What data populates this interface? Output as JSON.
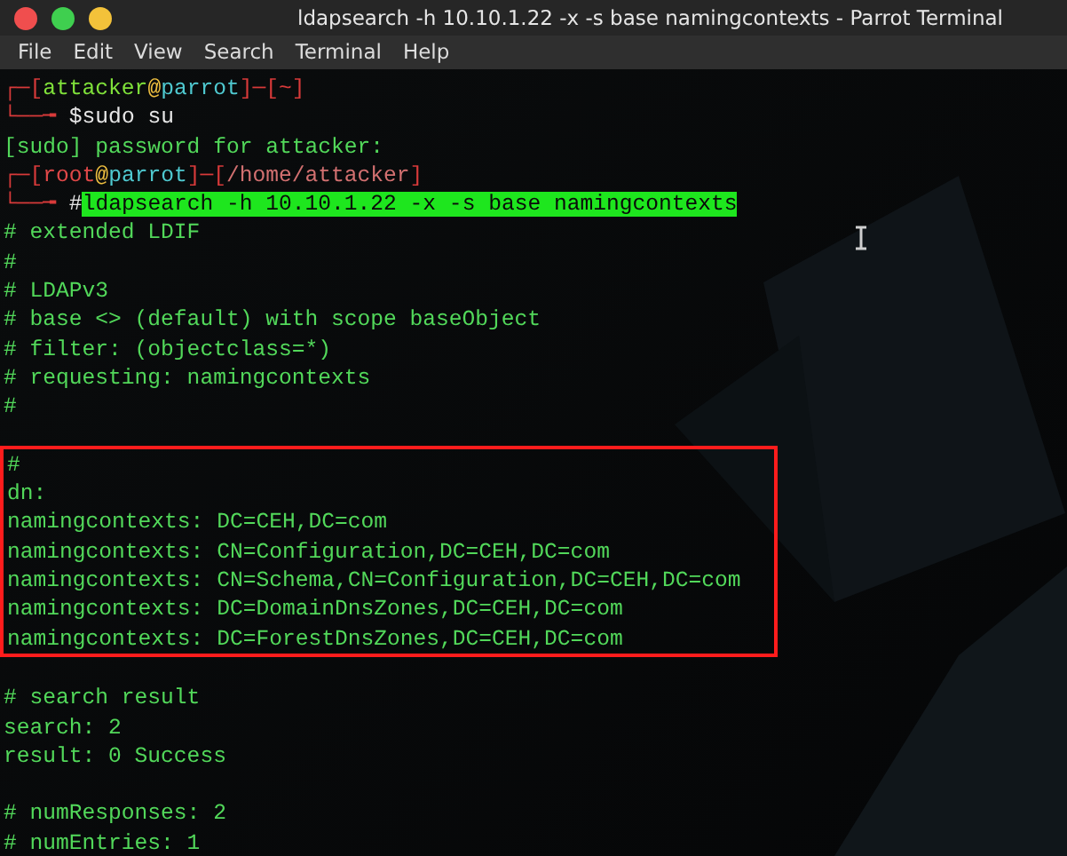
{
  "window": {
    "title": "ldapsearch -h 10.10.1.22 -x -s base namingcontexts - Parrot Terminal",
    "controls": [
      {
        "color": "#f04e4e"
      },
      {
        "color": "#3fcf4f"
      },
      {
        "color": "#f3c23a"
      }
    ]
  },
  "menu": [
    "File",
    "Edit",
    "View",
    "Search",
    "Terminal",
    "Help"
  ],
  "terminal": {
    "blocks": [
      {
        "kind": "plain",
        "lines": [
          {
            "segments": [
              {
                "kind": "frame",
                "text": "┌─["
              },
              {
                "kind": "user",
                "text": "attacker"
              },
              {
                "kind": "at",
                "text": "@"
              },
              {
                "kind": "host",
                "text": "parrot"
              },
              {
                "kind": "frame",
                "text": "]─["
              },
              {
                "kind": "frame",
                "text": "~"
              },
              {
                "kind": "frame",
                "text": "]"
              }
            ]
          },
          {
            "segments": [
              {
                "kind": "frame",
                "text": "└──╼ "
              },
              {
                "kind": "plain",
                "text": "$sudo su"
              }
            ]
          },
          {
            "segments": [
              {
                "kind": "out",
                "text": "[sudo] password for attacker:"
              }
            ]
          },
          {
            "segments": [
              {
                "kind": "frame",
                "text": "┌─["
              },
              {
                "kind": "root",
                "text": "root"
              },
              {
                "kind": "at",
                "text": "@"
              },
              {
                "kind": "host",
                "text": "parrot"
              },
              {
                "kind": "frame",
                "text": "]─["
              },
              {
                "kind": "path",
                "text": "/home/attacker"
              },
              {
                "kind": "frame",
                "text": "]"
              }
            ]
          },
          {
            "segments": [
              {
                "kind": "frame",
                "text": "└──╼ "
              },
              {
                "kind": "plain",
                "text": "#"
              },
              {
                "kind": "highlight",
                "text": "ldapsearch -h 10.10.1.22 -x -s base namingcontexts"
              }
            ]
          },
          {
            "segments": [
              {
                "kind": "out",
                "text": "# extended LDIF"
              }
            ]
          },
          {
            "segments": [
              {
                "kind": "out",
                "text": "#"
              }
            ]
          },
          {
            "segments": [
              {
                "kind": "out",
                "text": "# LDAPv3"
              }
            ]
          },
          {
            "segments": [
              {
                "kind": "out",
                "text": "# base <> (default) with scope baseObject"
              }
            ]
          },
          {
            "segments": [
              {
                "kind": "out",
                "text": "# filter: (objectclass=*)"
              }
            ]
          },
          {
            "segments": [
              {
                "kind": "out",
                "text": "# requesting: namingcontexts"
              }
            ]
          },
          {
            "segments": [
              {
                "kind": "out",
                "text": "#"
              }
            ]
          }
        ]
      },
      {
        "kind": "boxed",
        "lines": [
          {
            "segments": [
              {
                "kind": "out",
                "text": "#"
              }
            ]
          },
          {
            "segments": [
              {
                "kind": "out",
                "text": "dn:"
              }
            ]
          },
          {
            "segments": [
              {
                "kind": "out",
                "text": "namingcontexts: DC=CEH,DC=com"
              }
            ]
          },
          {
            "segments": [
              {
                "kind": "out",
                "text": "namingcontexts: CN=Configuration,DC=CEH,DC=com"
              }
            ]
          },
          {
            "segments": [
              {
                "kind": "out",
                "text": "namingcontexts: CN=Schema,CN=Configuration,DC=CEH,DC=com"
              }
            ]
          },
          {
            "segments": [
              {
                "kind": "out",
                "text": "namingcontexts: DC=DomainDnsZones,DC=CEH,DC=com"
              }
            ]
          },
          {
            "segments": [
              {
                "kind": "out",
                "text": "namingcontexts: DC=ForestDnsZones,DC=CEH,DC=com"
              }
            ]
          }
        ]
      },
      {
        "kind": "plain",
        "lines": [
          {
            "segments": [
              {
                "kind": "out",
                "text": "# search result"
              }
            ]
          },
          {
            "segments": [
              {
                "kind": "out",
                "text": "search: 2"
              }
            ]
          },
          {
            "segments": [
              {
                "kind": "out",
                "text": "result: 0 Success"
              }
            ]
          }
        ]
      },
      {
        "kind": "plain",
        "lines": [
          {
            "segments": [
              {
                "kind": "out",
                "text": "# numResponses: 2"
              }
            ]
          },
          {
            "segments": [
              {
                "kind": "out",
                "text": "# numEntries: 1"
              }
            ]
          }
        ]
      }
    ]
  }
}
